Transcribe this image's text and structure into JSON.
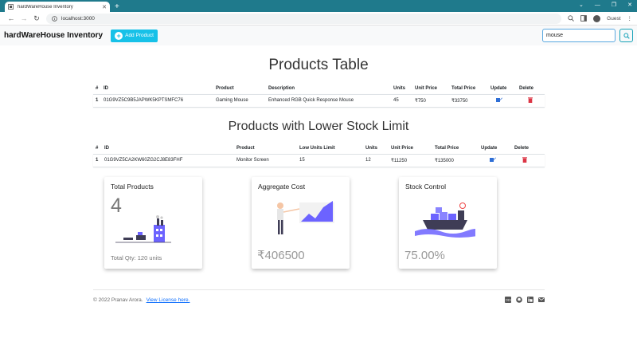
{
  "browser": {
    "tab_title": "hardWareHouse Inventory",
    "tab_close": "✕",
    "new_tab": "+",
    "url": "localhost:3000",
    "profile": "Guest",
    "controls": [
      "⌄",
      "—",
      "❐",
      "✕"
    ]
  },
  "nav": {
    "brand": "hardWareHouse Inventory",
    "add_button": "Add Product",
    "search_value": "mouse"
  },
  "products_table": {
    "title": "Products Table",
    "columns": [
      "#",
      "ID",
      "Product",
      "Description",
      "Units",
      "Unit Price",
      "Total Price",
      "Update",
      "Delete"
    ],
    "rows": [
      {
        "num": "1",
        "id": "01G9VZ5C9B5JAPWK5KPTSMFC76",
        "product": "Gaming Mouse",
        "description": "Enhanced RGB Quick Response Mouse",
        "units": "45",
        "unit_price": "₹750",
        "total_price": "₹33750"
      }
    ]
  },
  "low_stock_table": {
    "title": "Products with Lower Stock Limit",
    "columns": [
      "#",
      "ID",
      "Product",
      "Low Units Limit",
      "Units",
      "Unit Price",
      "Total Price",
      "Update",
      "Delete"
    ],
    "rows": [
      {
        "num": "1",
        "id": "01G9VZ5CA2KW60ZG2CJ8E83FHF",
        "product": "Monitor Screen",
        "low_limit": "15",
        "units": "12",
        "unit_price": "₹11250",
        "total_price": "₹135000"
      }
    ]
  },
  "cards": {
    "total_products": {
      "title": "Total Products",
      "count": "4",
      "qty": "Total Qty: 120 units"
    },
    "aggregate_cost": {
      "title": "Aggregate Cost",
      "value": "₹406500"
    },
    "stock_control": {
      "title": "Stock Control",
      "value": "75.00%"
    }
  },
  "footer": {
    "copyright": "© 2022 Pranav Arora.",
    "license_link": "View License here."
  },
  "colors": {
    "accent": "#17c1e8",
    "edit": "#2f6fd6",
    "delete": "#dc3545",
    "illustration": "#6c63ff"
  }
}
